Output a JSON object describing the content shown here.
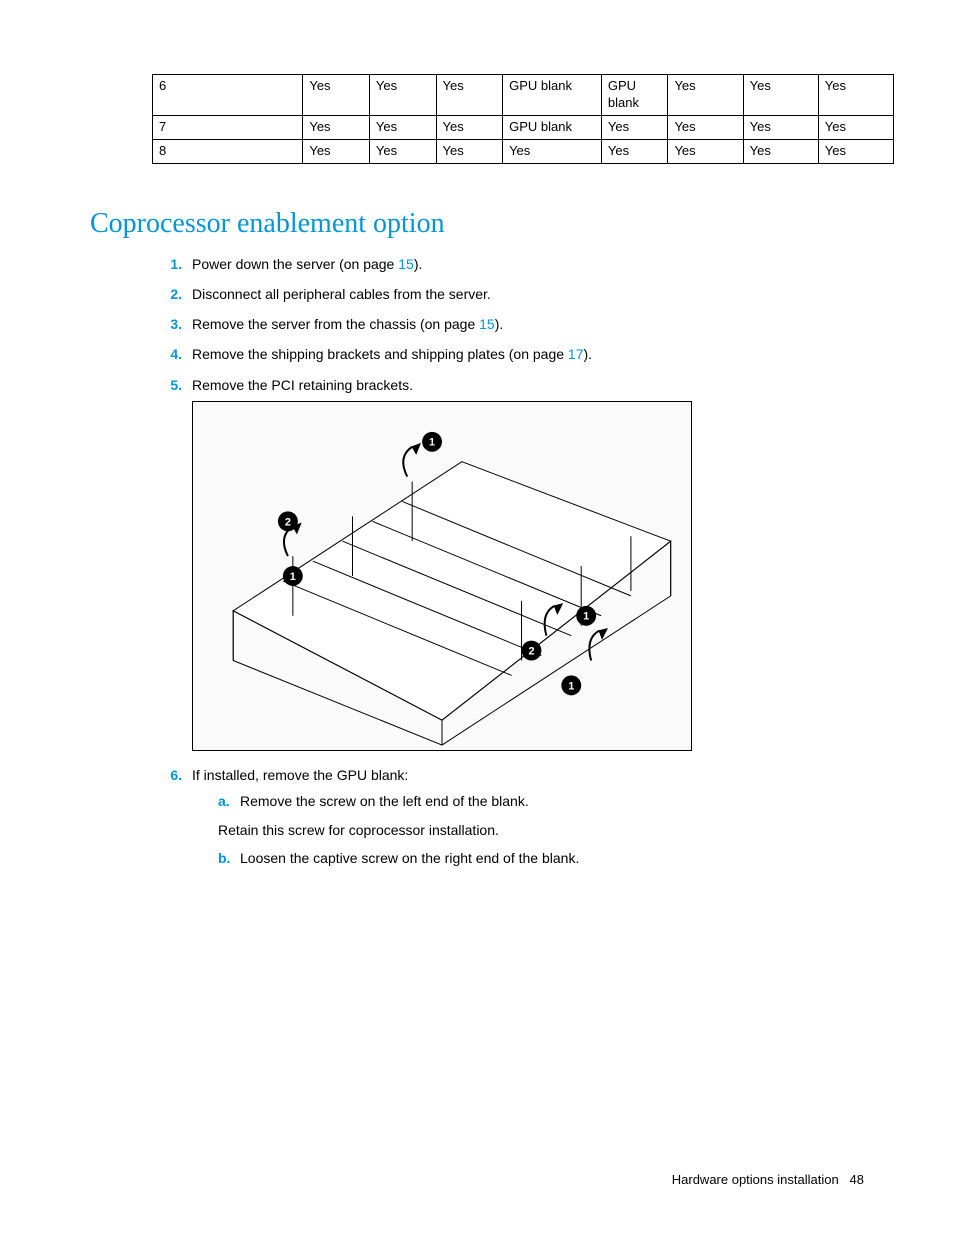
{
  "table": {
    "rows": [
      {
        "c0": "6",
        "c1": "Yes",
        "c2": "Yes",
        "c3": "Yes",
        "c4": "GPU blank",
        "c5": "GPU blank",
        "c6": "Yes",
        "c7": "Yes",
        "c8": "Yes"
      },
      {
        "c0": "7",
        "c1": "Yes",
        "c2": "Yes",
        "c3": "Yes",
        "c4": "GPU blank",
        "c5": "Yes",
        "c6": "Yes",
        "c7": "Yes",
        "c8": "Yes"
      },
      {
        "c0": "8",
        "c1": "Yes",
        "c2": "Yes",
        "c3": "Yes",
        "c4": "Yes",
        "c5": "Yes",
        "c6": "Yes",
        "c7": "Yes",
        "c8": "Yes"
      }
    ]
  },
  "heading": "Coprocessor enablement option",
  "steps": {
    "s1": {
      "num": "1.",
      "pre": "Power down the server (on page ",
      "link": "15",
      "post": ")."
    },
    "s2": {
      "num": "2.",
      "text": "Disconnect all peripheral cables from the server."
    },
    "s3": {
      "num": "3.",
      "pre": "Remove the server from the chassis (on page ",
      "link": "15",
      "post": ")."
    },
    "s4": {
      "num": "4.",
      "pre": "Remove the shipping brackets and shipping plates (on page ",
      "link": "17",
      "post": ")."
    },
    "s5": {
      "num": "5.",
      "text": "Remove the PCI retaining brackets."
    },
    "s6": {
      "num": "6.",
      "text": "If installed, remove the GPU blank:"
    }
  },
  "sub": {
    "a": {
      "lett": "a.",
      "text": "Remove the screw on the left end of the blank."
    },
    "retain": "Retain this screw for coprocessor installation.",
    "b": {
      "lett": "b.",
      "text": "Loosen the captive screw on the right end of the blank."
    }
  },
  "footer": {
    "label": "Hardware options installation",
    "page": "48"
  }
}
